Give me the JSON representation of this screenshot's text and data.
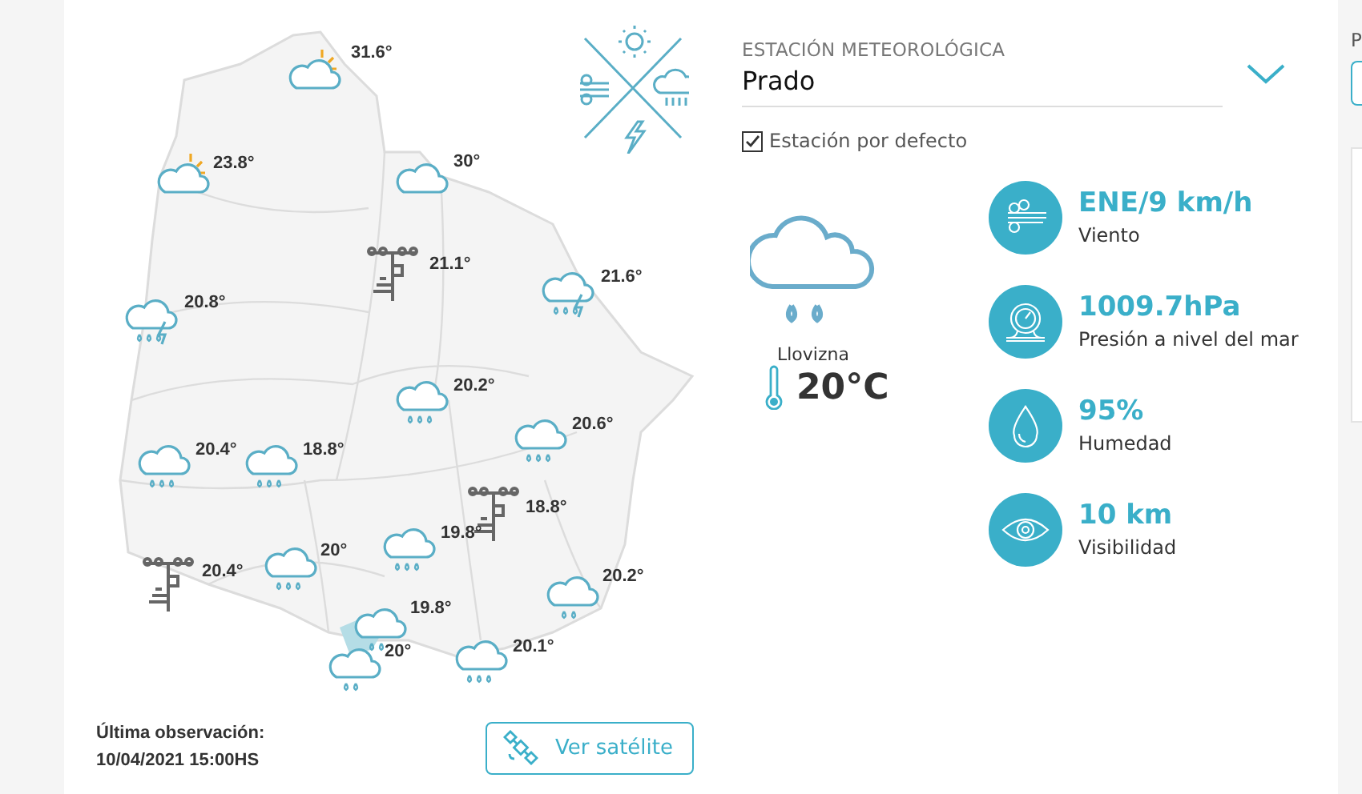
{
  "map": {
    "stations": [
      {
        "kind": "partly-sunny",
        "temp": "31.6°"
      },
      {
        "kind": "partly-sunny",
        "temp": "23.8°"
      },
      {
        "kind": "cloudy",
        "temp": "30°"
      },
      {
        "kind": "station",
        "temp": "21.1°"
      },
      {
        "kind": "thunderstorm",
        "temp": "21.6°"
      },
      {
        "kind": "thunderstorm",
        "temp": "20.8°"
      },
      {
        "kind": "rain",
        "temp": "20.2°"
      },
      {
        "kind": "rain",
        "temp": "20.6°"
      },
      {
        "kind": "rain",
        "temp": "20.4°"
      },
      {
        "kind": "rain",
        "temp": "18.8°"
      },
      {
        "kind": "station",
        "temp": "18.8°"
      },
      {
        "kind": "rain",
        "temp": "19.8°"
      },
      {
        "kind": "station",
        "temp": "20.4°"
      },
      {
        "kind": "rain",
        "temp": "20°"
      },
      {
        "kind": "drizzle",
        "temp": "20.2°"
      },
      {
        "kind": "drizzle",
        "temp": "19.8°"
      },
      {
        "kind": "drizzle",
        "temp": "20°"
      },
      {
        "kind": "rain",
        "temp": "20.1°"
      }
    ]
  },
  "observation": {
    "label": "Última observación:",
    "datetime": "10/04/2021 15:00HS"
  },
  "satellite_button": {
    "label": "Ver satélite"
  },
  "station_select": {
    "label": "ESTACIÓN METEOROLÓGICA",
    "value": "Prado"
  },
  "default_station": {
    "label": "Estación por defecto",
    "checked": true
  },
  "current": {
    "condition": "Llovizna",
    "temperature": "20°C"
  },
  "metrics": [
    {
      "kind": "wind",
      "value": "ENE/9 km/h",
      "label": "Viento"
    },
    {
      "kind": "pressure",
      "value": "1009.7hPa",
      "label": "Presión a nivel del mar"
    },
    {
      "kind": "humidity",
      "value": "95%",
      "label": "Humedad"
    },
    {
      "kind": "visibility",
      "value": "10 km",
      "label": "Visibilidad"
    }
  ],
  "side_column": {
    "label": "P"
  }
}
